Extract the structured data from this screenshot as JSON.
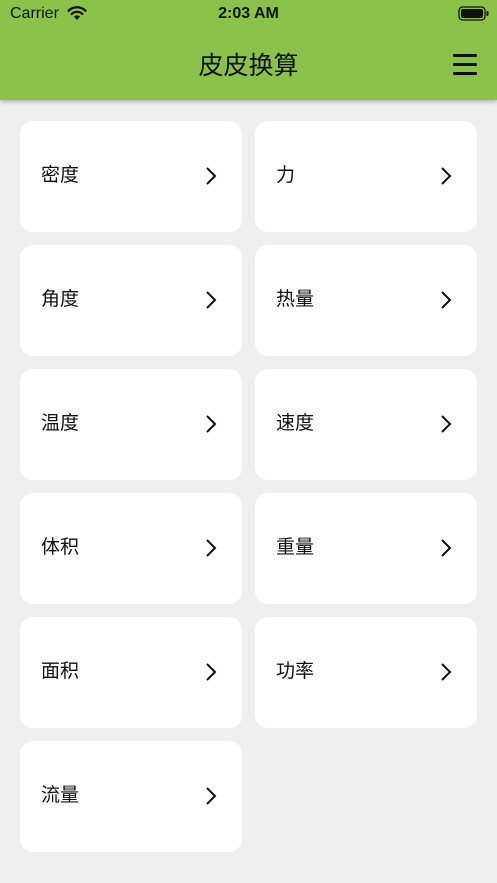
{
  "status_bar": {
    "carrier": "Carrier",
    "time": "2:03 AM"
  },
  "nav": {
    "title": "皮皮换算",
    "menu_icon": "hamburger-menu-icon"
  },
  "colors": {
    "header": "#8bc34a",
    "background": "#efefef",
    "card": "#ffffff"
  },
  "categories": [
    {
      "label": "密度"
    },
    {
      "label": "力"
    },
    {
      "label": "角度"
    },
    {
      "label": "热量"
    },
    {
      "label": "温度"
    },
    {
      "label": "速度"
    },
    {
      "label": "体积"
    },
    {
      "label": "重量"
    },
    {
      "label": "面积"
    },
    {
      "label": "功率"
    },
    {
      "label": "流量"
    }
  ]
}
